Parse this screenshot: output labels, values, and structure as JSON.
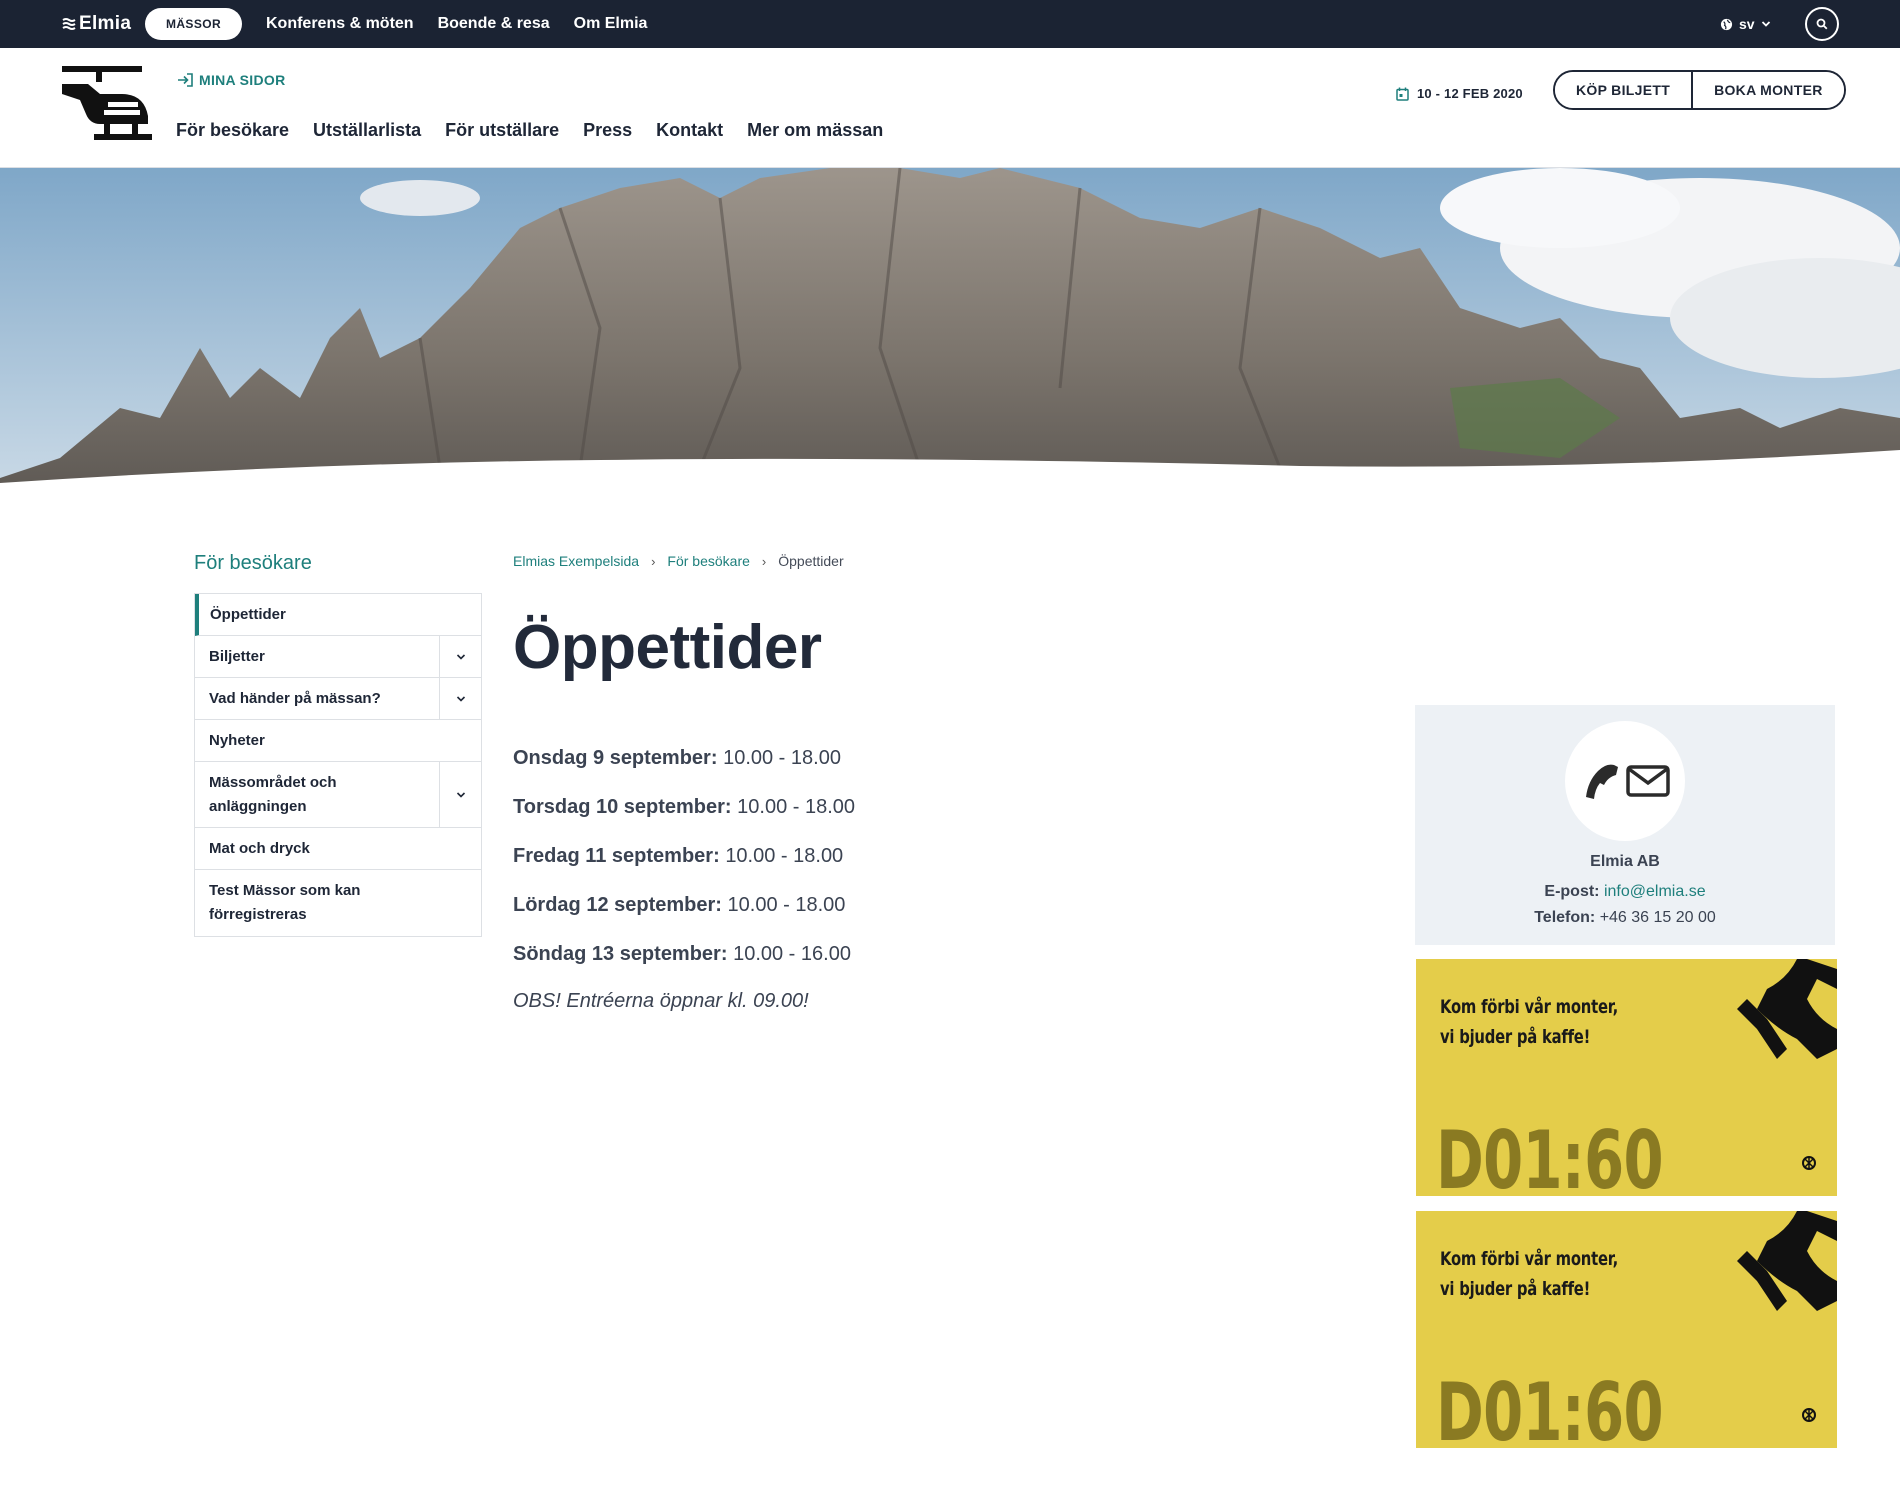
{
  "topbar": {
    "brand": "Elmia",
    "pill": "MÄSSOR",
    "links": [
      "Konferens & möten",
      "Boende & resa",
      "Om Elmia"
    ],
    "lang": "sv",
    "icons": {
      "lang": "globe-icon",
      "search": "search-icon"
    }
  },
  "header": {
    "mina_sidor": "MINA SIDOR",
    "nav": [
      "För besökare",
      "Utställarlista",
      "För utställare",
      "Press",
      "Kontakt",
      "Mer om mässan"
    ],
    "date": "10 - 12 FEB 2020",
    "buy_ticket": "KÖP BILJETT",
    "book_booth": "BOKA MONTER"
  },
  "sidebar": {
    "title": "För besökare",
    "items": [
      {
        "label": "Öppettider",
        "active": true,
        "expandable": false
      },
      {
        "label": "Biljetter",
        "active": false,
        "expandable": true
      },
      {
        "label": "Vad händer på mässan?",
        "active": false,
        "expandable": true
      },
      {
        "label": "Nyheter",
        "active": false,
        "expandable": false
      },
      {
        "label": "Mässområdet och anläggningen",
        "active": false,
        "expandable": true
      },
      {
        "label": "Mat och dryck",
        "active": false,
        "expandable": false
      },
      {
        "label": "Test Mässor som kan förregistreras",
        "active": false,
        "expandable": false
      }
    ]
  },
  "breadcrumb": [
    "Elmias Exempelsida",
    "För besökare",
    "Öppettider"
  ],
  "page": {
    "title": "Öppettider",
    "hours": [
      {
        "day": "Onsdag 9 september:",
        "time": "10.00 - 18.00"
      },
      {
        "day": "Torsdag 10 september:",
        "time": "10.00 - 18.00"
      },
      {
        "day": "Fredag 11 september:",
        "time": "10.00 - 18.00"
      },
      {
        "day": "Lördag 12 september:",
        "time": "10.00 - 18.00"
      },
      {
        "day": "Söndag 13 september:",
        "time": "10.00 - 16.00"
      }
    ],
    "note": "OBS! Entréerna öppnar kl. 09.00!"
  },
  "contact": {
    "company": "Elmia AB",
    "email_label": "E-post:",
    "email": "info@elmia.se",
    "phone_label": "Telefon:",
    "phone": "+46 36 15 20 00"
  },
  "ads": [
    {
      "line1": "Kom förbi vår monter,",
      "line2": "vi bjuder på kaffe!",
      "code": "D01:60"
    },
    {
      "line1": "Kom förbi vår monter,",
      "line2": "vi bjuder på kaffe!",
      "code": "D01:60"
    }
  ],
  "colors": {
    "accent": "#1e7f7c",
    "dark": "#1b2333",
    "ad_yellow": "#e4cd4a"
  }
}
